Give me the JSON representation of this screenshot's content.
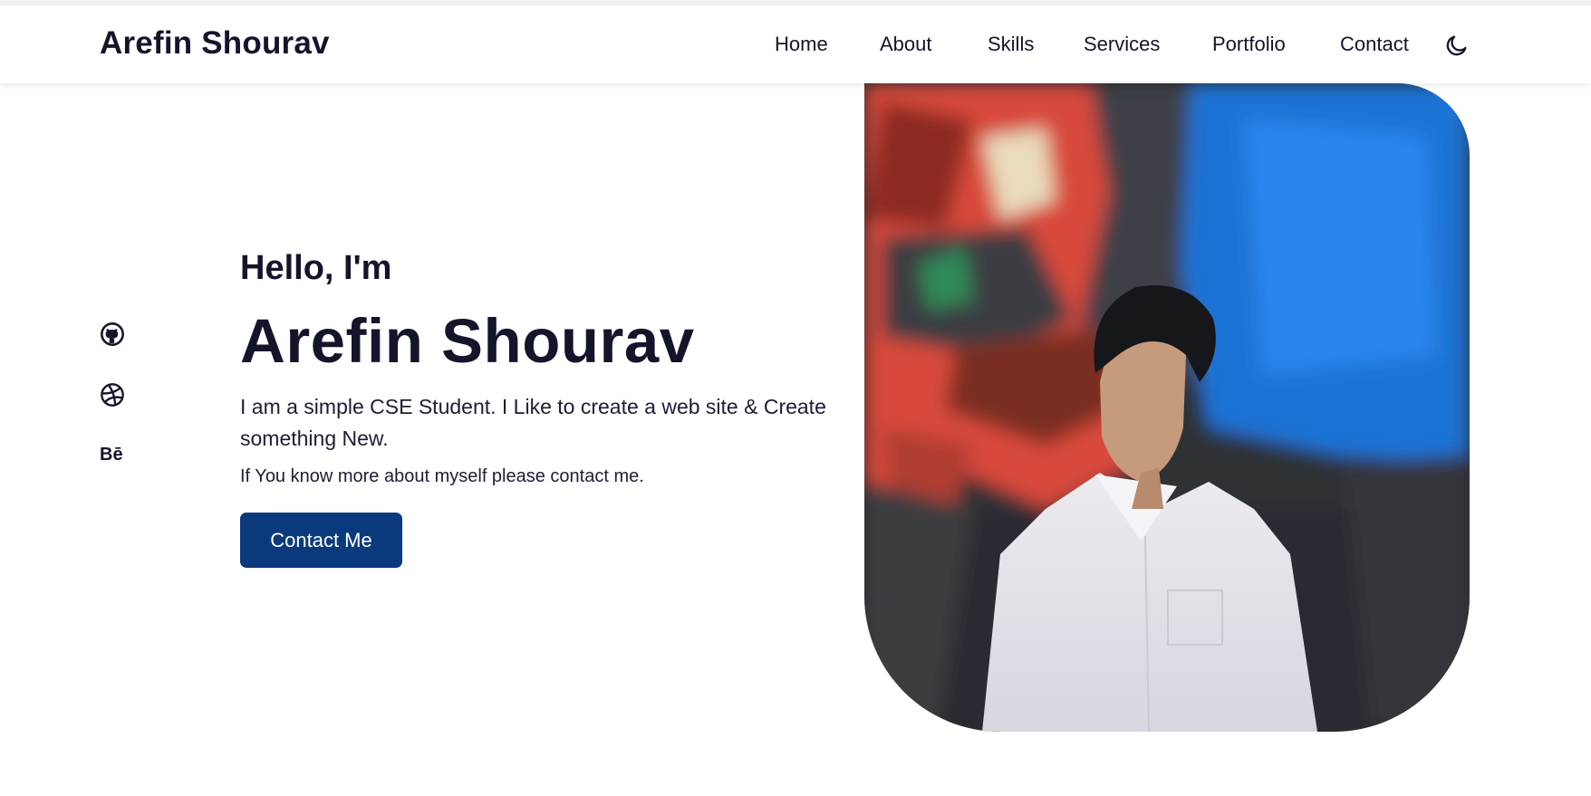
{
  "header": {
    "logo": "Arefin Shourav",
    "nav": [
      {
        "label": "Home"
      },
      {
        "label": "About"
      },
      {
        "label": "Skills"
      },
      {
        "label": "Services"
      },
      {
        "label": "Portfolio"
      },
      {
        "label": "Contact"
      }
    ],
    "theme_icon": "moon-icon"
  },
  "socials": [
    {
      "icon": "github-icon"
    },
    {
      "icon": "dribbble-icon"
    },
    {
      "icon": "behance-icon",
      "text": "Bē"
    }
  ],
  "hero": {
    "greeting": "Hello, I'm",
    "name": "Arefin Shourav",
    "description": "I am a simple CSE Student. I Like to create a web site & Create something New.",
    "subtext": "If You know more about myself please contact me.",
    "cta_label": "Contact Me"
  },
  "colors": {
    "text": "#14142b",
    "cta_background": "#0b3a7c",
    "cta_text": "#ffffff"
  }
}
